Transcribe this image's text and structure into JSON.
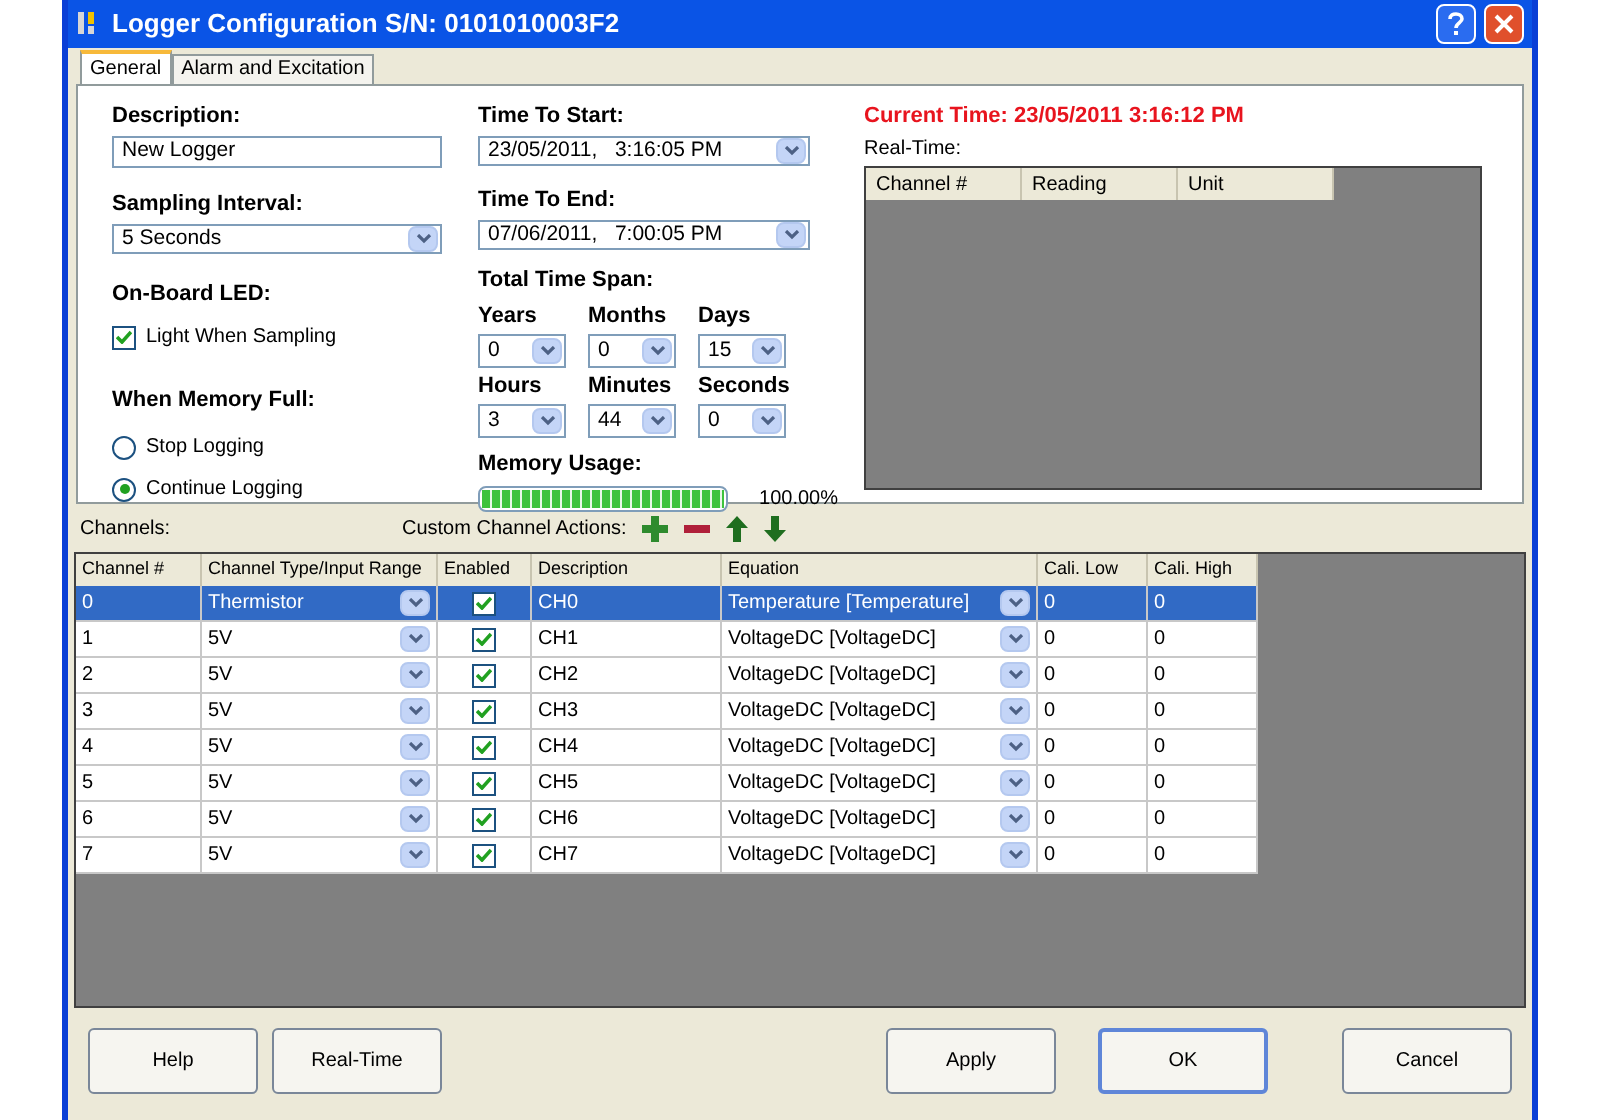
{
  "window": {
    "title": "Logger Configuration S/N: 0101010003F2"
  },
  "tabs": [
    {
      "label": "General",
      "selected": true
    },
    {
      "label": "Alarm and Excitation",
      "selected": false
    }
  ],
  "general": {
    "description": {
      "label": "Description:",
      "value": "New Logger"
    },
    "sampling_interval": {
      "label": "Sampling Interval:",
      "value": "5 Seconds"
    },
    "onboard_led": {
      "label": "On-Board LED:",
      "checkbox": {
        "label": "Light When Sampling",
        "checked": true
      }
    },
    "memory_full": {
      "label": "When Memory Full:",
      "options": [
        {
          "label": "Stop Logging",
          "selected": false
        },
        {
          "label": "Continue Logging",
          "selected": true
        }
      ]
    },
    "time_to_start": {
      "label": "Time To Start:",
      "value": "23/05/2011,   3:16:05 PM"
    },
    "time_to_end": {
      "label": "Time To End:",
      "value": "07/06/2011,   7:00:05 PM"
    },
    "total_time_span": {
      "label": "Total Time Span:",
      "fields": [
        {
          "label": "Years",
          "value": "0"
        },
        {
          "label": "Months",
          "value": "0"
        },
        {
          "label": "Days",
          "value": "15"
        },
        {
          "label": "Hours",
          "value": "3"
        },
        {
          "label": "Minutes",
          "value": "44"
        },
        {
          "label": "Seconds",
          "value": "0"
        }
      ]
    },
    "memory_usage": {
      "label": "Memory Usage:",
      "level": 1,
      "reading": "100.00%"
    },
    "current_time": "Current Time: 23/05/2011 3:16:12 PM",
    "real_time": {
      "label": "Real-Time:",
      "columns": [
        "Channel #",
        "Reading",
        "Unit"
      ]
    }
  },
  "channels": {
    "label": "Channels:",
    "actions_label": "Custom Channel Actions:",
    "actions": [
      {
        "kind": "add"
      },
      {
        "kind": "remove"
      },
      {
        "kind": "up"
      },
      {
        "kind": "down"
      }
    ],
    "columns": [
      "Channel #",
      "Channel Type/Input Range",
      "Enabled",
      "Description",
      "Equation",
      "Cali. Low",
      "Cali. High"
    ],
    "rows": [
      {
        "channel": "0",
        "type": "Thermistor",
        "enabled": true,
        "description": "CH0",
        "equation": "Temperature [Temperature]",
        "cali_low": "0",
        "cali_high": "0",
        "selected": true
      },
      {
        "channel": "1",
        "type": "5V",
        "enabled": true,
        "description": "CH1",
        "equation": "VoltageDC [VoltageDC]",
        "cali_low": "0",
        "cali_high": "0",
        "selected": false
      },
      {
        "channel": "2",
        "type": "5V",
        "enabled": true,
        "description": "CH2",
        "equation": "VoltageDC [VoltageDC]",
        "cali_low": "0",
        "cali_high": "0",
        "selected": false
      },
      {
        "channel": "3",
        "type": "5V",
        "enabled": true,
        "description": "CH3",
        "equation": "VoltageDC [VoltageDC]",
        "cali_low": "0",
        "cali_high": "0",
        "selected": false
      },
      {
        "channel": "4",
        "type": "5V",
        "enabled": true,
        "description": "CH4",
        "equation": "VoltageDC [VoltageDC]",
        "cali_low": "0",
        "cali_high": "0",
        "selected": false
      },
      {
        "channel": "5",
        "type": "5V",
        "enabled": true,
        "description": "CH5",
        "equation": "VoltageDC [VoltageDC]",
        "cali_low": "0",
        "cali_high": "0",
        "selected": false
      },
      {
        "channel": "6",
        "type": "5V",
        "enabled": true,
        "description": "CH6",
        "equation": "VoltageDC [VoltageDC]",
        "cali_low": "0",
        "cali_high": "0",
        "selected": false
      },
      {
        "channel": "7",
        "type": "5V",
        "enabled": true,
        "description": "CH7",
        "equation": "VoltageDC [VoltageDC]",
        "cali_low": "0",
        "cali_high": "0",
        "selected": false
      }
    ]
  },
  "left_buttons": [
    {
      "label": "Help",
      "default": false
    },
    {
      "label": "Real-Time",
      "default": false
    }
  ],
  "right_buttons": [
    {
      "label": "Apply",
      "default": false
    },
    {
      "label": "OK",
      "default": true
    },
    {
      "label": "Cancel",
      "default": false
    }
  ]
}
